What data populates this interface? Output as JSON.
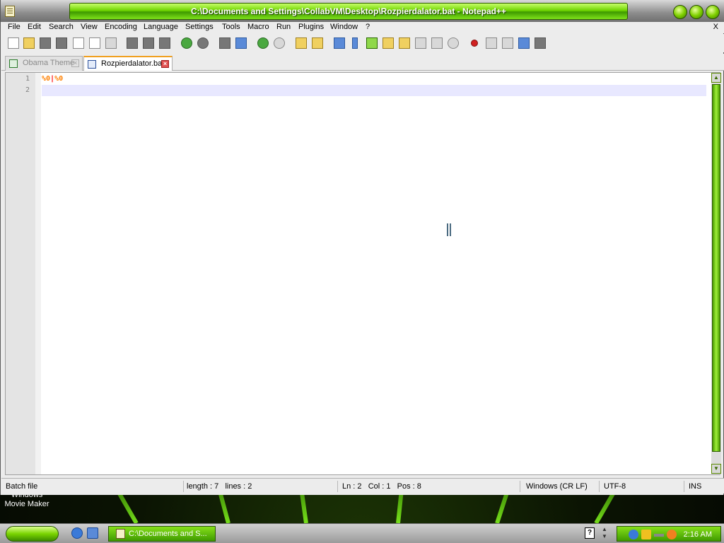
{
  "window": {
    "title": "C:\\Documents and Settings\\CollabVM\\Desktop\\Rozpierdalator.bat - Notepad++",
    "menu": [
      "File",
      "Edit",
      "Search",
      "View",
      "Encoding",
      "Language",
      "Settings",
      "Tools",
      "Macro",
      "Run",
      "Plugins",
      "Window",
      "?"
    ],
    "menu_close": "X"
  },
  "tabs": [
    {
      "label": "Obama Theme",
      "active": false
    },
    {
      "label": "Rozpierdalator.bat",
      "active": true
    }
  ],
  "editor": {
    "line_numbers": [
      "1",
      "2"
    ],
    "line1": {
      "var1": "%0",
      "op": "|",
      "var2": "%0"
    },
    "line2": ""
  },
  "status": {
    "filetype": "Batch file",
    "length": "length : 7",
    "lines": "lines : 2",
    "ln": "Ln : 2",
    "col": "Col : 1",
    "pos": "Pos : 8",
    "eol": "Windows (CR LF)",
    "encoding": "UTF-8",
    "mode": "INS"
  },
  "desktop": {
    "icon_label": "Windows Movie Maker"
  },
  "taskbar": {
    "task_label": "C:\\Documents and S...",
    "help_glyph": "?",
    "clock": "2:16 AM"
  },
  "colors": {
    "accent_green": "#6fd400",
    "batch_var": "#ff8000",
    "batch_op": "#ff0000",
    "current_line": "#e8e8ff"
  },
  "icons": {
    "toolbar": [
      "new-file-icon",
      "open-file-icon",
      "save-icon",
      "save-all-icon",
      "close-icon",
      "close-all-icon",
      "print-icon",
      "cut-icon",
      "copy-icon",
      "paste-icon",
      "undo-icon",
      "redo-icon",
      "find-icon",
      "replace-icon",
      "zoom-in-icon",
      "zoom-out-icon",
      "sync-v-icon",
      "sync-h-icon",
      "word-wrap-icon",
      "show-all-chars-icon",
      "indent-guide-icon",
      "doc-map-icon",
      "function-list-icon",
      "folder-workspace-icon",
      "monitoring-icon",
      "record-macro-icon",
      "stop-macro-icon",
      "play-macro-icon",
      "run-macro-multiple-icon",
      "save-macro-icon"
    ]
  }
}
